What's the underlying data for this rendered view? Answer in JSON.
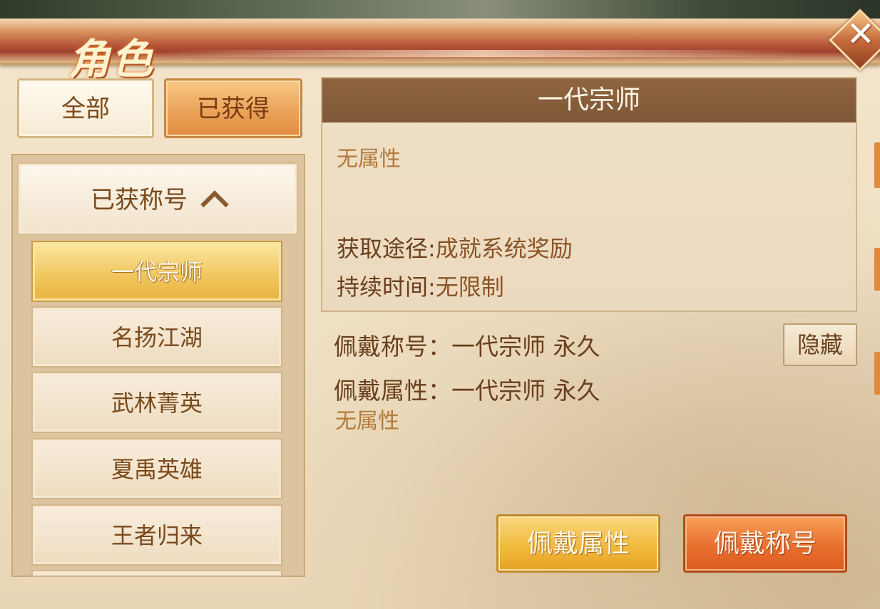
{
  "header": {
    "title": "角色"
  },
  "filter_tabs": {
    "all": "全部",
    "owned": "已获得"
  },
  "list": {
    "group_label": "已获称号",
    "items": [
      {
        "label": "一代宗师"
      },
      {
        "label": "名扬江湖"
      },
      {
        "label": "武林菁英"
      },
      {
        "label": "夏禹英雄"
      },
      {
        "label": "王者归来"
      }
    ],
    "selected_index": 0
  },
  "detail": {
    "title": "一代宗师",
    "attribute": "无属性",
    "source_label": "获取途径:",
    "source_value": "成就系统奖励",
    "duration_label": "持续时间:",
    "duration_value": "无限制"
  },
  "wearing": {
    "title_label": "佩戴称号：",
    "title_value": "一代宗师 永久",
    "attr_label": "佩戴属性：",
    "attr_value": "一代宗师 永久",
    "attr_desc": "无属性",
    "hide_button": "隐藏"
  },
  "actions": {
    "wear_attr": "佩戴属性",
    "wear_title": "佩戴称号"
  },
  "colors": {
    "accent_orange": "#e9702f",
    "accent_gold": "#f0b83a",
    "text_brown": "#6a3f1c",
    "attr_text": "#b27a3a"
  }
}
